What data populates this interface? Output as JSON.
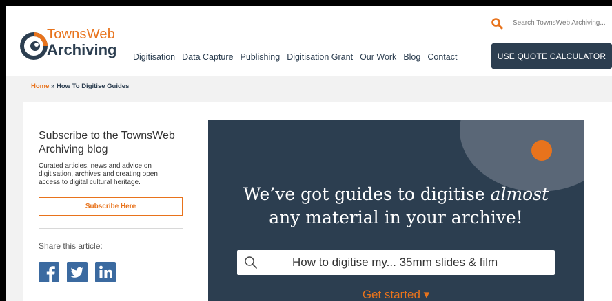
{
  "logo": {
    "line1": "TownsWeb",
    "line2": "Archiving"
  },
  "nav": {
    "items": [
      "Digitisation",
      "Data Capture",
      "Publishing",
      "Digitisation Grant",
      "Our Work",
      "Blog",
      "Contact"
    ]
  },
  "search": {
    "placeholder": "Search TownsWeb Archiving..."
  },
  "quote_button": {
    "label": "USE QUOTE CALCULATOR"
  },
  "breadcrumb": {
    "home": "Home",
    "separator": " » ",
    "current": "How To Digitise Guides"
  },
  "sidebar": {
    "subscribe_title": "Subscribe to the TownsWeb Archiving blog",
    "subscribe_desc": "Curated articles, news and advice on digitisation, archives and creating open access to digital cultural heritage.",
    "subscribe_button": "Subscribe Here",
    "share_label": "Share this article:",
    "social_icons": [
      "facebook-icon",
      "twitter-icon",
      "linkedin-icon"
    ]
  },
  "hero": {
    "heading_part1": "We’ve got guides to digitise ",
    "heading_em": "almost",
    "heading_part2": "any material in your archive!",
    "search_text": "How to digitise my... 35mm slides & film",
    "cta": "Get started ▾"
  },
  "colors": {
    "accent": "#e8731c",
    "navy": "#2c3e50",
    "social_blue": "#3b6aa0"
  }
}
